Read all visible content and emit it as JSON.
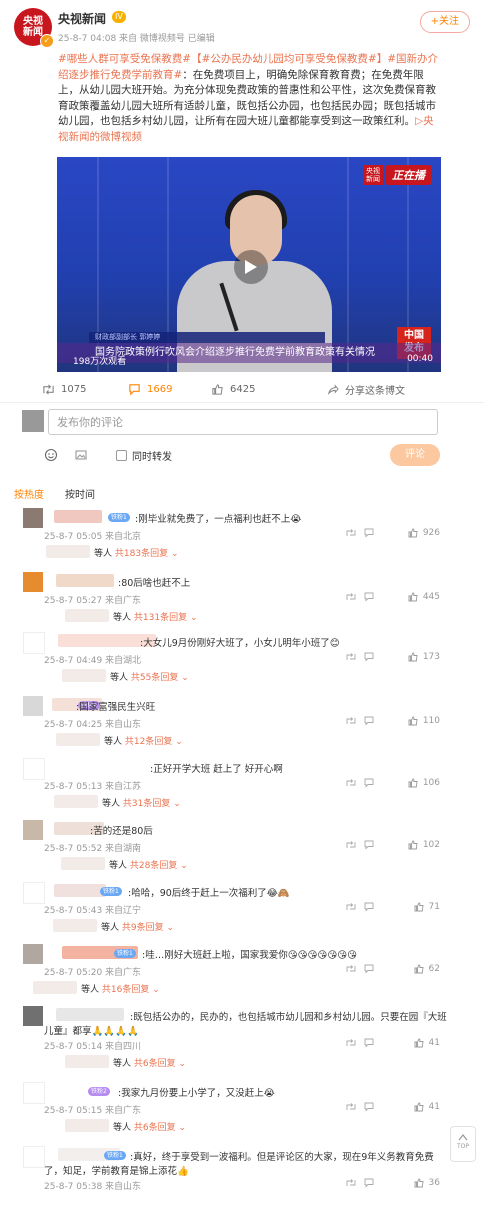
{
  "post": {
    "author": "央视新闻",
    "avatar_text": "央视\n新闻",
    "level_badge": "IV",
    "meta": "25-8-7 04:08  来自 微博视频号 已编辑",
    "follow": "+关注",
    "text_segments": [
      {
        "type": "tag",
        "text": "#哪些人群可享受免保教费#"
      },
      {
        "type": "tag",
        "text": "【#公办民办幼儿园均可享受免保教费#】"
      },
      {
        "type": "tag",
        "text": "#国新办介绍逐步推行免费学前教育#"
      },
      {
        "type": "plain",
        "text": "：在免费项目上，明确免除保育教育费；在免费年限上，从幼儿园大班开始。为充分体现免费政策的普惠性和公平性，这次免费保育教育政策覆盖幼儿园大班所有适龄儿童，既包括公办园，也包括民办园；既包括城市幼儿园，也包括乡村幼儿园，让所有在园大班儿童都能享受到这一政策红利。"
      },
      {
        "type": "link",
        "text": "▷央视新闻的微博视频"
      }
    ],
    "video": {
      "logo_small": "央视\n新闻",
      "logo_text": "正在播",
      "china_logo": "中国\n发布",
      "speaker_strip": "财政部副部长 郭婷婷",
      "caption": "国务院政策例行吹风会介绍逐步推行免费学前教育政策有关情况",
      "views": "198万次观看",
      "duration": "00:40"
    },
    "actions": {
      "repost": "1075",
      "comment": "1669",
      "like": "6425",
      "share": "分享这条博文"
    }
  },
  "reply": {
    "placeholder": "发布你的评论",
    "repost_label": "同时转发",
    "submit": "评论"
  },
  "sort": {
    "hot": "按热度",
    "time": "按时间"
  },
  "comments": [
    {
      "text": ":刚毕业就免费了，一点福利也赶不上😭",
      "meta": "25-8-7 05:05 来自北京",
      "likes": "926",
      "replies_prefix": "等人",
      "replies": "共183条回复",
      "badge": "铁粉1"
    },
    {
      "text": ":80后啥也赶不上",
      "meta": "25-8-7 05:27 来自广东",
      "likes": "445",
      "replies_prefix": "等人",
      "replies": "共131条回复",
      "badge": ""
    },
    {
      "text": ":大女儿9月份刚好大班了，小女儿明年小班了😊",
      "meta": "25-8-7 04:49 来自湖北",
      "likes": "173",
      "replies_prefix": "等人",
      "replies": "共55条回复",
      "badge": ""
    },
    {
      "text": ":国家富强民生兴旺",
      "meta": "25-8-7 04:25 来自山东",
      "likes": "110",
      "replies_prefix": "等人",
      "replies": "共12条回复",
      "badge": "铁粉2"
    },
    {
      "text": ":正好开学大班 赶上了 好开心啊",
      "meta": "25-8-7 05:13 来自江苏",
      "likes": "106",
      "replies_prefix": "等人",
      "replies": "共31条回复",
      "badge": ""
    },
    {
      "text": ":苦的还是80后",
      "meta": "25-8-7 05:52 来自湖南",
      "likes": "102",
      "replies_prefix": "等人",
      "replies": "共28条回复",
      "badge": ""
    },
    {
      "text": ":哈哈，90后终于赶上一次福利了😂🙈",
      "meta": "25-8-7 05:43 来自辽宁",
      "likes": "71",
      "replies_prefix": "等人",
      "replies": "共9条回复",
      "badge": "铁粉1"
    },
    {
      "text": ":哇…刚好大班赶上啦，国家我爱你😘😘😘😘😘😘😘",
      "meta": "25-8-7 05:20 来自广东",
      "likes": "62",
      "replies_prefix": "等人",
      "replies": "共16条回复",
      "badge": "铁粉1"
    },
    {
      "text": ":既包括公办的，民办的，也包括城市幼儿园和乡村幼儿园。只要在园『大班",
      "text2": "儿童』都享🙏🙏🙏🙏",
      "meta": "25-8-7 05:14 来自四川",
      "likes": "41",
      "replies_prefix": "等人",
      "replies": "共6条回复",
      "badge": ""
    },
    {
      "text": ":我家九月份要上小学了，又没赶上😭",
      "meta": "25-8-7 05:15 来自广东",
      "likes": "41",
      "replies_prefix": "等人",
      "replies": "共6条回复",
      "badge": "铁粉2"
    },
    {
      "text": ":真好，终于享受到一波福利。但是评论区的大家，现在9年义务教育免费",
      "text2": "了，知足，学前教育是锦上添花👍",
      "meta": "25-8-7 05:38 来自山东",
      "likes": "36",
      "replies_prefix": "",
      "replies": "",
      "badge": "铁粉1"
    }
  ],
  "top_button": "TOP"
}
